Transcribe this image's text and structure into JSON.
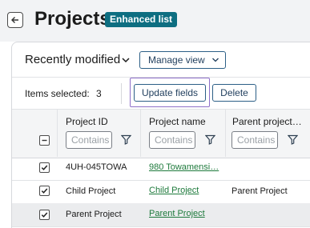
{
  "header": {
    "title": "Projects",
    "badge": "Enhanced list"
  },
  "view": {
    "name": "Recently modified",
    "manage_label": "Manage view"
  },
  "selection": {
    "label": "Items selected:",
    "count": "3"
  },
  "actions": {
    "update_label": "Update fields",
    "delete_label": "Delete"
  },
  "table": {
    "columns": [
      {
        "label": "Project ID",
        "filter_placeholder": "Contains"
      },
      {
        "label": "Project name",
        "filter_placeholder": "Contains"
      },
      {
        "label": "Parent project…",
        "filter_placeholder": "Contains"
      }
    ],
    "rows": [
      {
        "checked": true,
        "id": "4UH-045TOWA",
        "name": "980 Towamensi…",
        "parent": ""
      },
      {
        "checked": true,
        "id": "Child Project",
        "name": "Child Project",
        "parent": "Parent Project"
      },
      {
        "checked": true,
        "id": "Parent Project",
        "name": "Parent Project",
        "parent": ""
      }
    ]
  },
  "colors": {
    "accent": "#0e6e81",
    "link": "#1e7a3c",
    "button_border": "#2c5f86",
    "focus": "#8d6fc8"
  },
  "icons": [
    "back-arrow-icon",
    "chevron-down-icon",
    "filter-icon",
    "checkbox-checked-icon",
    "checkbox-indeterminate-icon"
  ]
}
